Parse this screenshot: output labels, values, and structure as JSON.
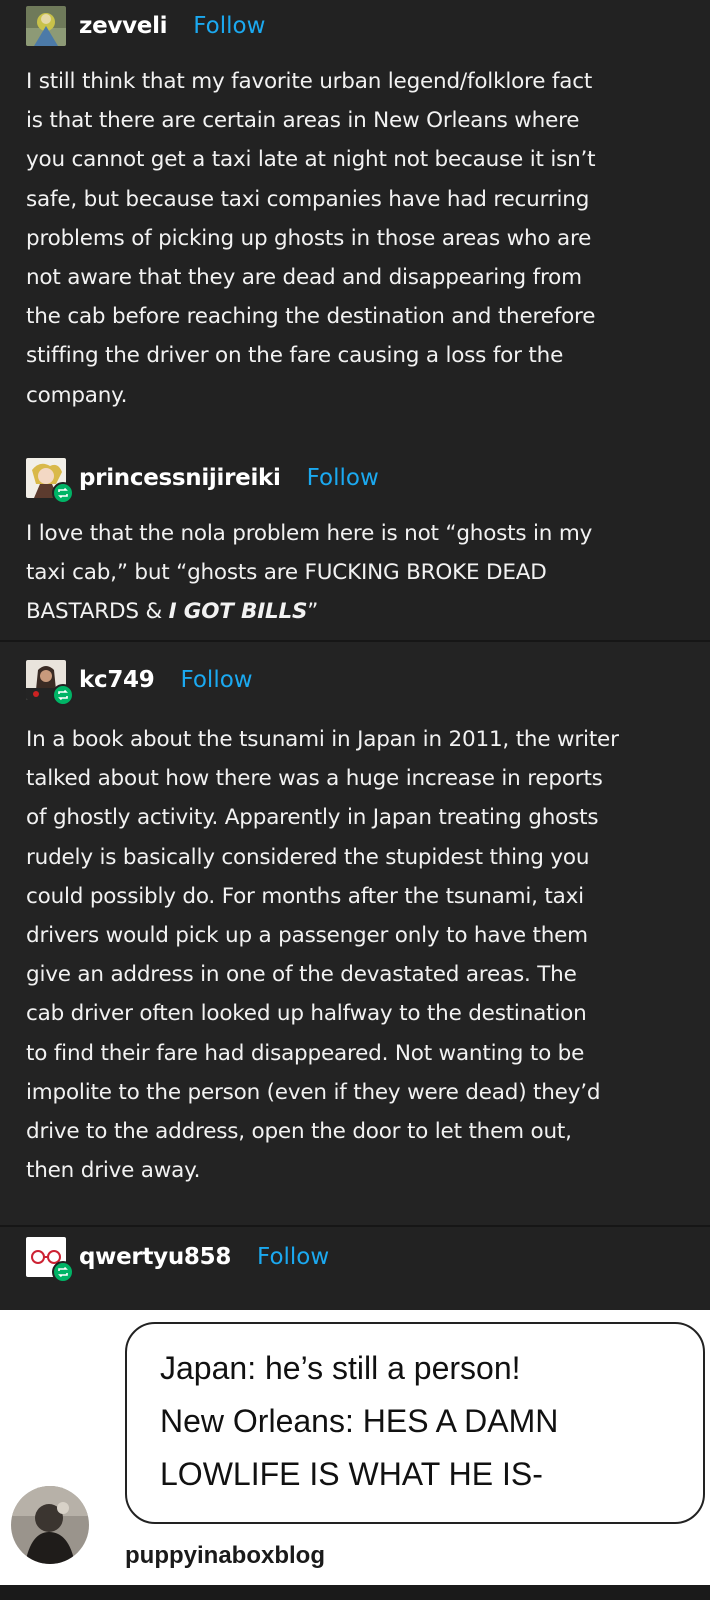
{
  "posts": [
    {
      "username": "zevveli",
      "follow_label": "Follow",
      "lines": [
        "I still think that my favorite urban legend/folklore fact",
        "is that there are certain areas in New Orleans where",
        "you cannot get a taxi late at night not because it isn’t",
        "safe, but because taxi companies have had recurring",
        "problems of picking up ghosts in those areas who are",
        "not aware that they are dead and disappearing from",
        "the cab before reaching the destination and therefore",
        "stiffing the driver on the fare causing a loss for the",
        "company."
      ]
    },
    {
      "username": "princessnijireiki",
      "follow_label": "Follow",
      "lines": [
        "I love that the nola problem here is not “ghosts in my",
        "taxi cab,” but “ghosts are FUCKING BROKE DEAD"
      ],
      "last_line_plain": "BASTARDS & ",
      "last_line_emph": "I GOT BILLS",
      "last_line_close": "”"
    },
    {
      "username": "kc749",
      "follow_label": "Follow",
      "lines": [
        "In a book about the tsunami in Japan in 2011, the writer",
        "talked about how there was a huge increase in reports",
        "of ghostly activity. Apparently in Japan treating ghosts",
        "rudely is basically considered the stupidest thing you",
        "could possibly do. For months after the tsunami, taxi",
        "drivers would pick up a passenger only to have them",
        "give an address in one of the devastated areas. The",
        "cab driver often looked up halfway to the destination",
        "to find their fare had disappeared. Not wanting to be",
        "impolite to the person (even if they were dead) they’d",
        "drive to the address, open the door to let them out,",
        "then drive away."
      ]
    },
    {
      "username": "qwertyu858",
      "follow_label": "Follow"
    }
  ],
  "meme": {
    "bubble_lines": [
      "Japan: he’s still a person!",
      "New Orleans: HES A DAMN",
      "LOWLIFE IS WHAT HE IS-"
    ],
    "credit": "puppyinaboxblog"
  },
  "colors": {
    "follow": "#1ba9f0",
    "reblog_badge": "#00b466",
    "background": "#222222"
  },
  "icons": {
    "reblog": "reblog-icon"
  }
}
